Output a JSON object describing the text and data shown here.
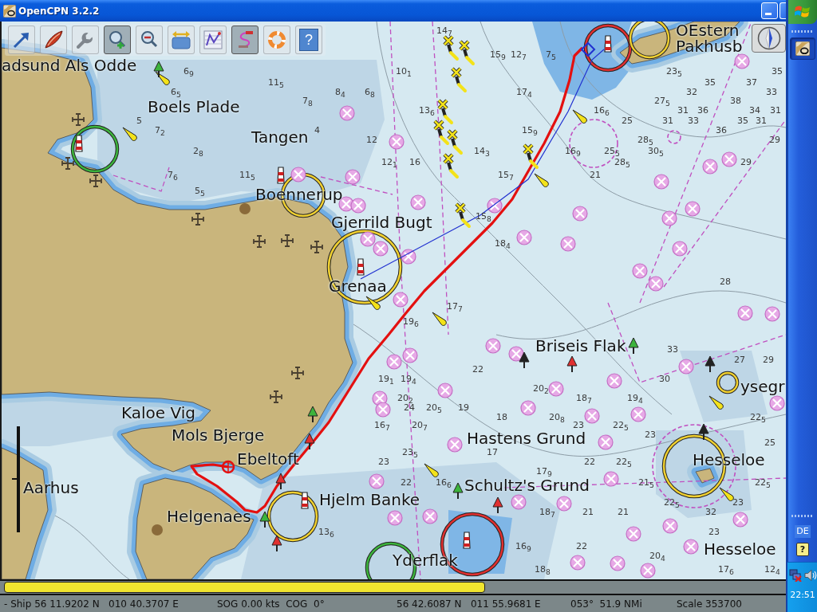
{
  "window": {
    "title": "OpenCPN 3.2.2"
  },
  "toolbar": {
    "buttons": [
      {
        "on": false
      },
      {
        "on": false
      },
      {
        "on": false
      },
      {
        "on": true
      },
      {
        "on": false
      },
      {
        "on": false
      },
      {
        "on": false
      },
      {
        "on": true
      },
      {
        "on": false
      },
      {
        "on": false,
        "label": "?"
      }
    ]
  },
  "chart": {
    "place_names": [
      "OEstern",
      "Pakhusb",
      "adsund Als Odde",
      "Boels Plade",
      "Tangen",
      "Boennerup",
      "Gjerrild Bugt",
      "Grenaa",
      "Briseis Flak",
      "ysegr",
      "Kaloe Vig",
      "Mols Bjerge",
      "Hastens Grund",
      "Ebeltoft",
      "Hesseloe",
      "Aarhus",
      "Schultz's Grund",
      "Hjelm Banke",
      "Helgenaes",
      "Hesseloe",
      "Yderflak"
    ],
    "soundings": [
      "14$_{7}$",
      "15$_{9}$",
      "12$_{7}$",
      "7$_{5}$",
      "6$_{9}$",
      "10$_{1}$",
      "23$_{5}$",
      "35",
      "11$_{5}$",
      "35",
      "37",
      "6$_{5}$",
      "8$_{4}$",
      "6$_{8}$",
      "17$_{4}$",
      "32",
      "33",
      "7$_{8}$",
      "27$_{5}$",
      "38",
      "13$_{6}$",
      "16$_{6}$",
      "31",
      "36",
      "34",
      "31",
      "5",
      "25",
      "31",
      "33",
      "35",
      "31",
      "7$_{2}$",
      "4",
      "15$_{9}$",
      "36",
      "12",
      "28$_{5}$",
      "29",
      "2$_{8}$",
      "14$_{3}$",
      "16$_{9}$",
      "25$_{5}$",
      "30$_{5}$",
      "12$_{1}$",
      "16",
      "28$_{5}$",
      "29",
      "7$_{6}$",
      "11$_{5}$",
      "15$_{7}$",
      "21",
      "5$_{5}$",
      "15$_{8}$",
      "18$_{4}$",
      "28",
      "17$_{7}$",
      "19$_{6}$",
      "33",
      "27",
      "29",
      "22",
      "19$_{1}$",
      "19$_{4}$",
      "30",
      "20$_{2}$",
      "20$_{2}$",
      "18$_{7}$",
      "19$_{4}$",
      "24",
      "20$_{5}$",
      "19",
      "18",
      "20$_{8}$",
      "22$_{5}$",
      "16$_{7}$",
      "20$_{7}$",
      "23",
      "22$_{5}$",
      "23",
      "25",
      "23$_{5}$",
      "17",
      "23",
      "22",
      "22$_{5}$",
      "17$_{9}$",
      "22",
      "16$_{6}$",
      "21$_{5}$",
      "22$_{5}$",
      "22$_{5}$",
      "23",
      "18$_{7}$",
      "21",
      "21",
      "32",
      "13$_{6}$",
      "23",
      "16$_{9}$",
      "22",
      "20$_{4}$",
      "18$_{8}$",
      "17$_{6}$",
      "12$_{4}$"
    ]
  },
  "status_bar": {
    "fields": [
      "- Ship 56 11.9202 N   010 40.3707 E",
      "SOG 0.00 kts  COG  0°",
      "56 42.6087 N   011 55.9681 E",
      "053°  51.9 NMi",
      "Scale 353700"
    ]
  },
  "taskbar": {
    "window_buttons": [
      {
        "selected": true
      }
    ],
    "language": "DE",
    "help": "?",
    "clock": "22:51"
  }
}
